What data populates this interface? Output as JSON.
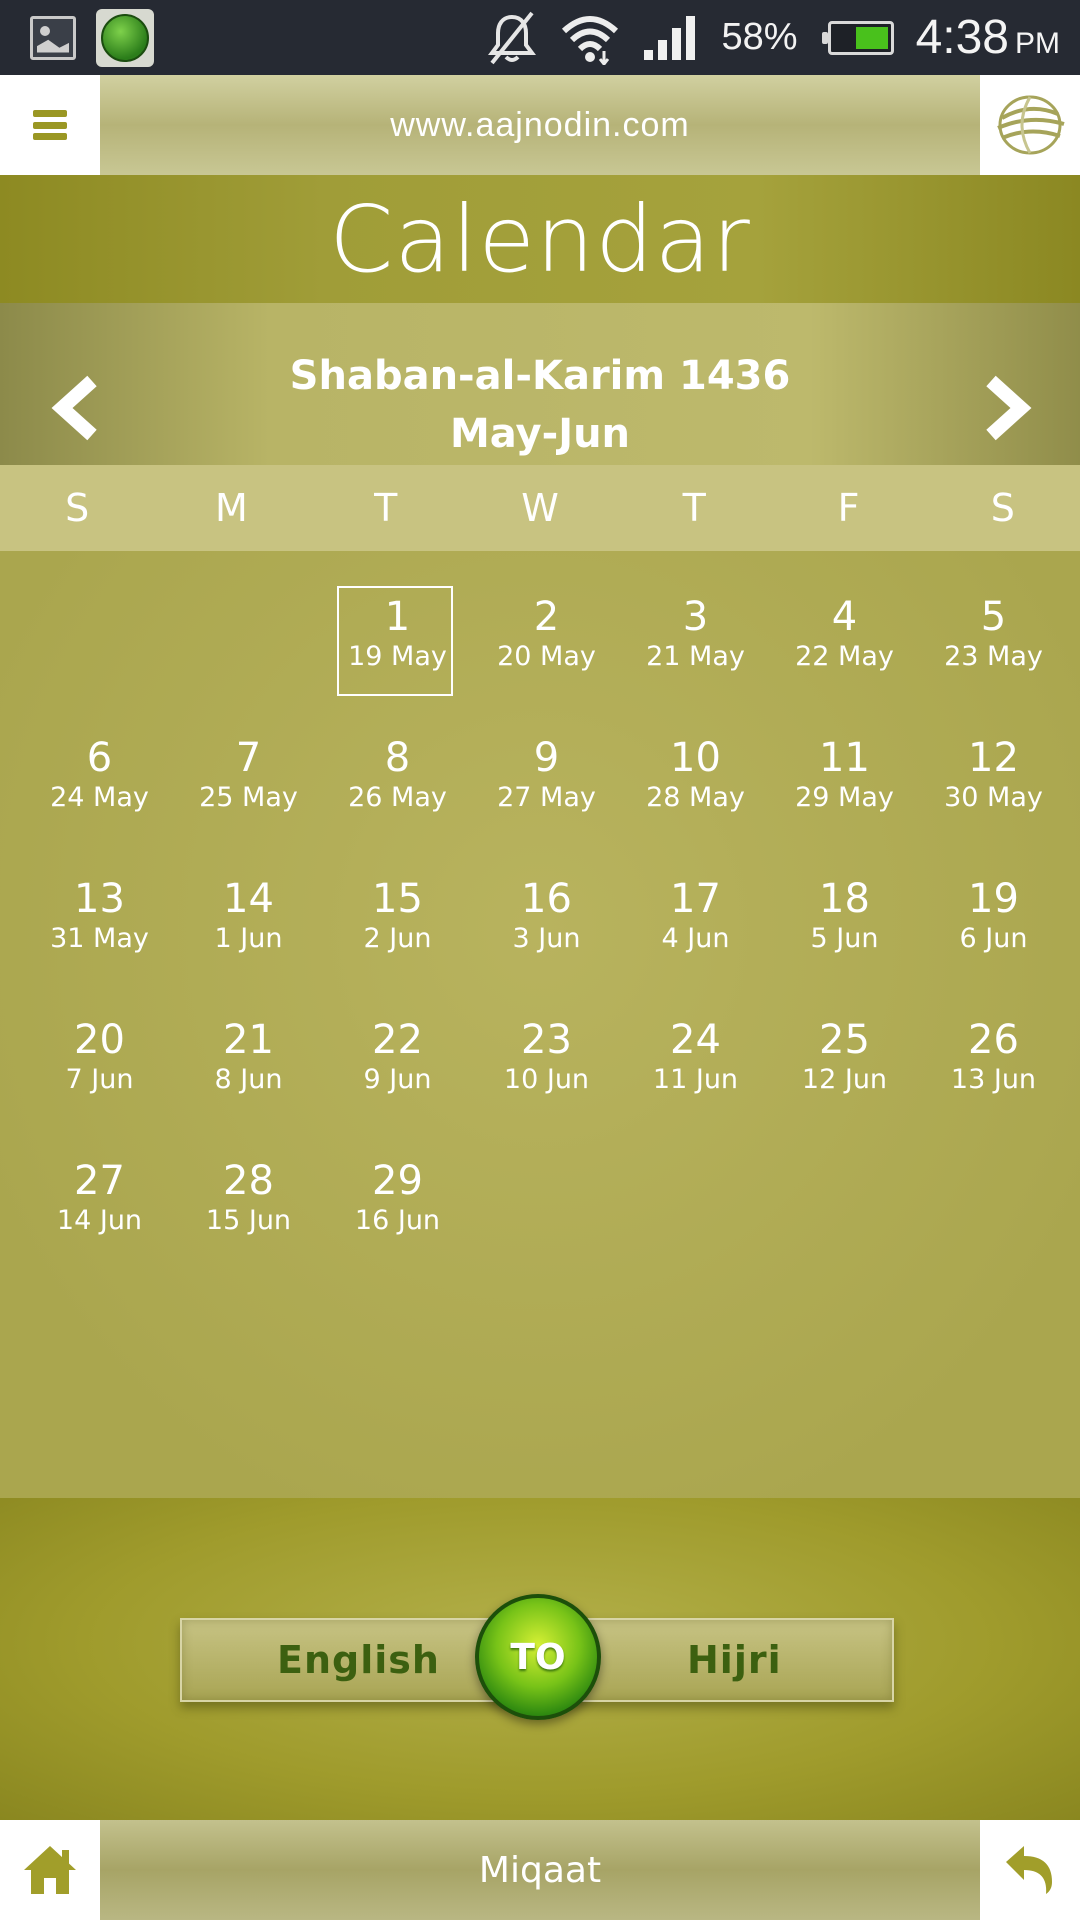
{
  "status_bar": {
    "battery_percent": "58%",
    "battery_level": 0.58,
    "time": "4:38",
    "ampm": "PM",
    "icons": [
      "gallery-icon",
      "app-globe-icon",
      "bell-muted-icon",
      "wifi-icon",
      "signal-icon",
      "battery-icon"
    ]
  },
  "top_bar": {
    "url": "www.aajnodin.com",
    "menu_icon": "hamburger-icon",
    "logo_icon": "globe-logo-icon"
  },
  "calendar": {
    "title": "Calendar",
    "hijri_month": "Shaban-al-Karim 1436",
    "greg_months": "May-Jun",
    "weekdays": [
      "S",
      "M",
      "T",
      "W",
      "T",
      "F",
      "S"
    ],
    "leading_blanks": 2,
    "days": [
      {
        "h": "1",
        "g": "19 May",
        "today": true
      },
      {
        "h": "2",
        "g": "20 May"
      },
      {
        "h": "3",
        "g": "21 May"
      },
      {
        "h": "4",
        "g": "22 May"
      },
      {
        "h": "5",
        "g": "23 May"
      },
      {
        "h": "6",
        "g": "24 May"
      },
      {
        "h": "7",
        "g": "25 May"
      },
      {
        "h": "8",
        "g": "26 May"
      },
      {
        "h": "9",
        "g": "27 May"
      },
      {
        "h": "10",
        "g": "28 May"
      },
      {
        "h": "11",
        "g": "29 May"
      },
      {
        "h": "12",
        "g": "30 May"
      },
      {
        "h": "13",
        "g": "31 May"
      },
      {
        "h": "14",
        "g": "1 Jun"
      },
      {
        "h": "15",
        "g": "2 Jun"
      },
      {
        "h": "16",
        "g": "3 Jun"
      },
      {
        "h": "17",
        "g": "4 Jun"
      },
      {
        "h": "18",
        "g": "5 Jun"
      },
      {
        "h": "19",
        "g": "6 Jun"
      },
      {
        "h": "20",
        "g": "7 Jun"
      },
      {
        "h": "21",
        "g": "8 Jun"
      },
      {
        "h": "22",
        "g": "9 Jun"
      },
      {
        "h": "23",
        "g": "10 Jun"
      },
      {
        "h": "24",
        "g": "11 Jun"
      },
      {
        "h": "25",
        "g": "12 Jun"
      },
      {
        "h": "26",
        "g": "13 Jun"
      },
      {
        "h": "27",
        "g": "14 Jun"
      },
      {
        "h": "28",
        "g": "15 Jun"
      },
      {
        "h": "29",
        "g": "16 Jun"
      }
    ]
  },
  "converter": {
    "left_label": "English",
    "to_label": "TO",
    "right_label": "Hijri"
  },
  "bottom_bar": {
    "label": "Miqaat",
    "home_icon": "home-icon",
    "back_icon": "back-arrow-icon"
  },
  "colors": {
    "accent": "#9a9723",
    "title_band": "#a09d38",
    "toggle_green": "#78c318",
    "label_green": "#3c6010"
  }
}
